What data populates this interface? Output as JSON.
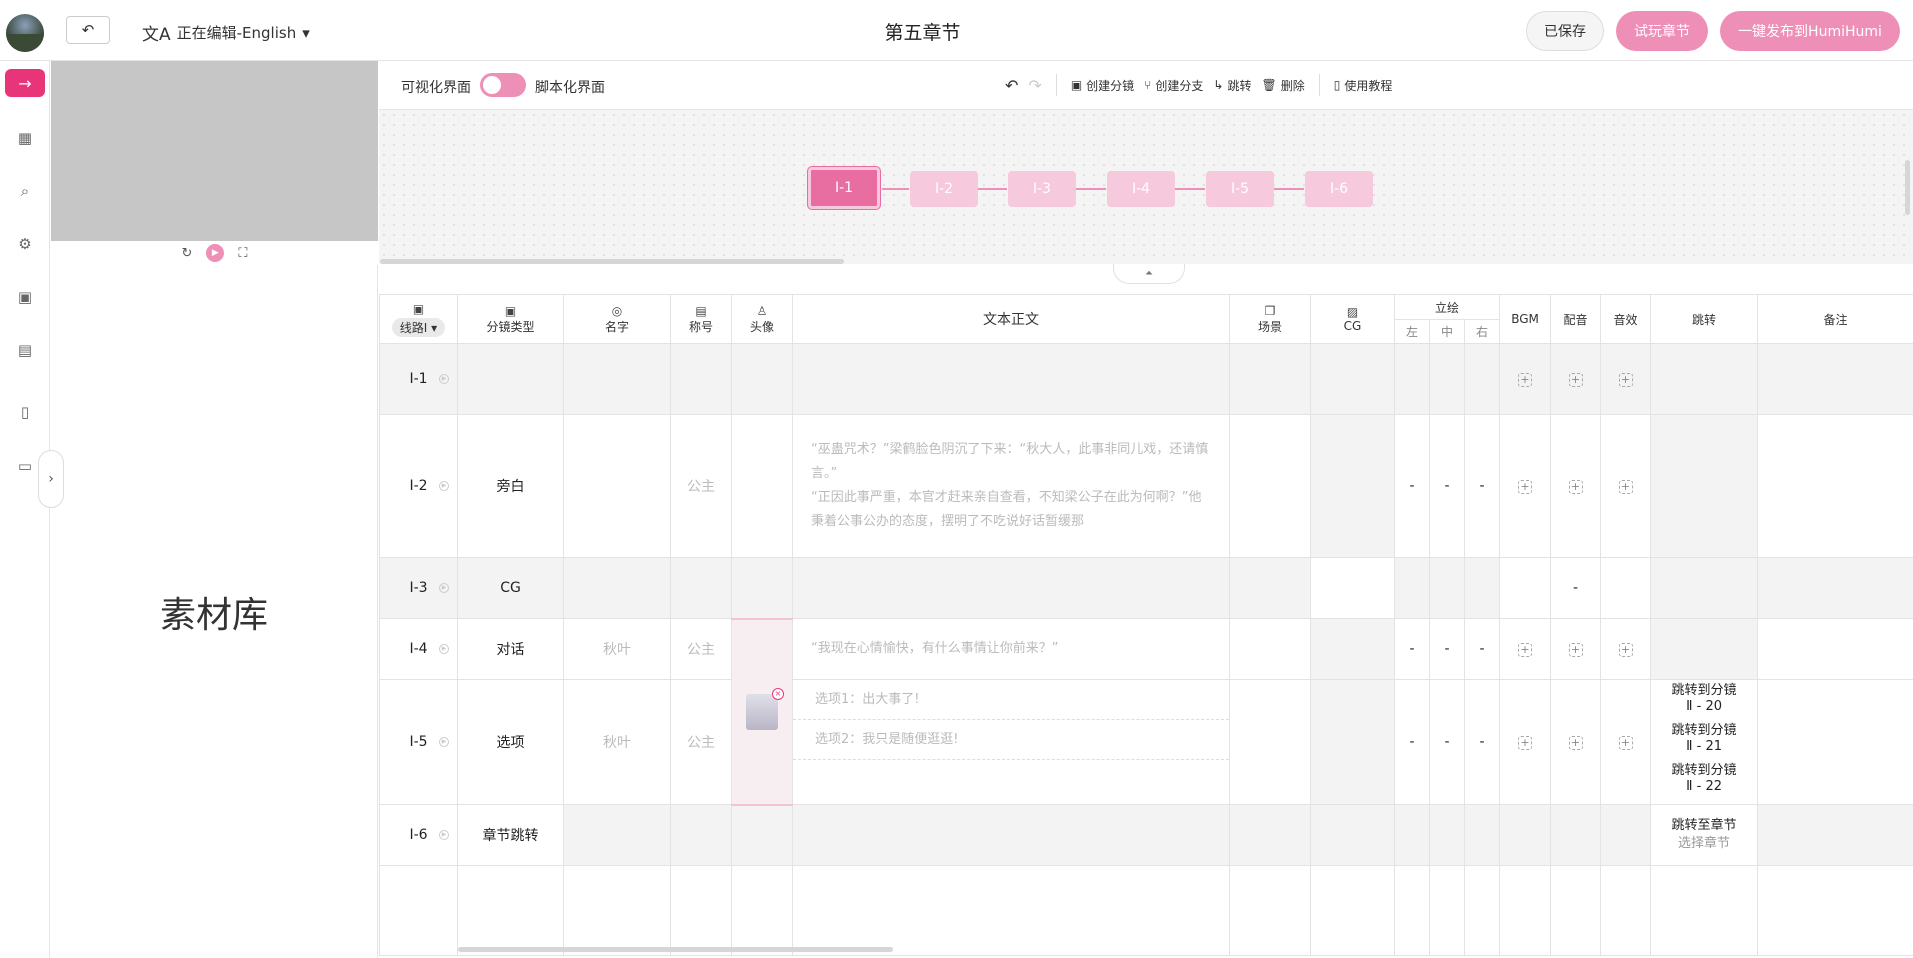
{
  "header": {
    "undo_icon": "↶",
    "lang_icon": "文A",
    "lang_label": "正在编辑-English",
    "lang_caret": "▾",
    "title": "第五章节",
    "saved": "已保存",
    "trial": "试玩章节",
    "publish": "一键发布到HumiHumi"
  },
  "nav": {
    "active_icon": "→",
    "icons": [
      "▦",
      "⌕",
      "⚙",
      "▣",
      "▤",
      "▯",
      "▭"
    ]
  },
  "preview": {
    "refresh": "↻",
    "play": "▶",
    "fullscreen": "⛶"
  },
  "library": {
    "label": "素材库",
    "toggle": "›"
  },
  "toolbar": {
    "visual": "可视化界面",
    "script": "脚本化界面",
    "undo": "↶",
    "redo": "↷",
    "create_shot": "创建分镜",
    "create_branch": "创建分支",
    "jump": "跳转",
    "delete": "删除",
    "tutorial": "使用教程"
  },
  "graph": {
    "nodes": [
      "I-1",
      "I-2",
      "I-3",
      "I-4",
      "I-5",
      "I-6"
    ],
    "active": "I-1"
  },
  "table": {
    "headers": {
      "route": "线路Ⅰ",
      "shot_type": "分镜类型",
      "name": "名字",
      "title": "称号",
      "avatar": "头像",
      "text": "文本正文",
      "scene": "场景",
      "cg": "CG",
      "standing": "立绘",
      "left": "左",
      "mid": "中",
      "right": "右",
      "bgm": "BGM",
      "voice": "配音",
      "sfx": "音效",
      "jump": "跳转",
      "note": "备注"
    },
    "rows": [
      {
        "id": "I-1",
        "type": ""
      },
      {
        "id": "I-2",
        "type": "旁白",
        "title": "公主",
        "text": "“巫蛊咒术？”梁鹤脸色阴沉了下来：“秋大人，此事非同儿戏，还请慎言。”",
        "text2": "“正因此事严重，本官才赶来亲自查看，不知梁公子在此为何啊？”他秉着公事公办的态度，摆明了不吃说好话暂缓那"
      },
      {
        "id": "I-3",
        "type": "CG",
        "voice": "-"
      },
      {
        "id": "I-4",
        "type": "对话",
        "name": "秋叶",
        "title": "公主",
        "text": "“我现在心情愉快，有什么事情让你前来？”"
      },
      {
        "id": "I-5",
        "type": "选项",
        "name": "秋叶",
        "title": "公主",
        "opt1": "选项1：出大事了!",
        "opt2": "选项2：我只是随便逛逛!",
        "jumps": [
          {
            "label": "跳转到分镜",
            "route": "Ⅱ",
            "num": "20"
          },
          {
            "label": "跳转到分镜",
            "route": "Ⅱ",
            "num": "21"
          },
          {
            "label": "跳转到分镜",
            "route": "Ⅱ",
            "num": "22"
          }
        ]
      },
      {
        "id": "I-6",
        "type": "章节跳转",
        "jump_label": "跳转至章节",
        "jump_select": "选择章节"
      }
    ],
    "dash": "-",
    "plus": "+"
  }
}
